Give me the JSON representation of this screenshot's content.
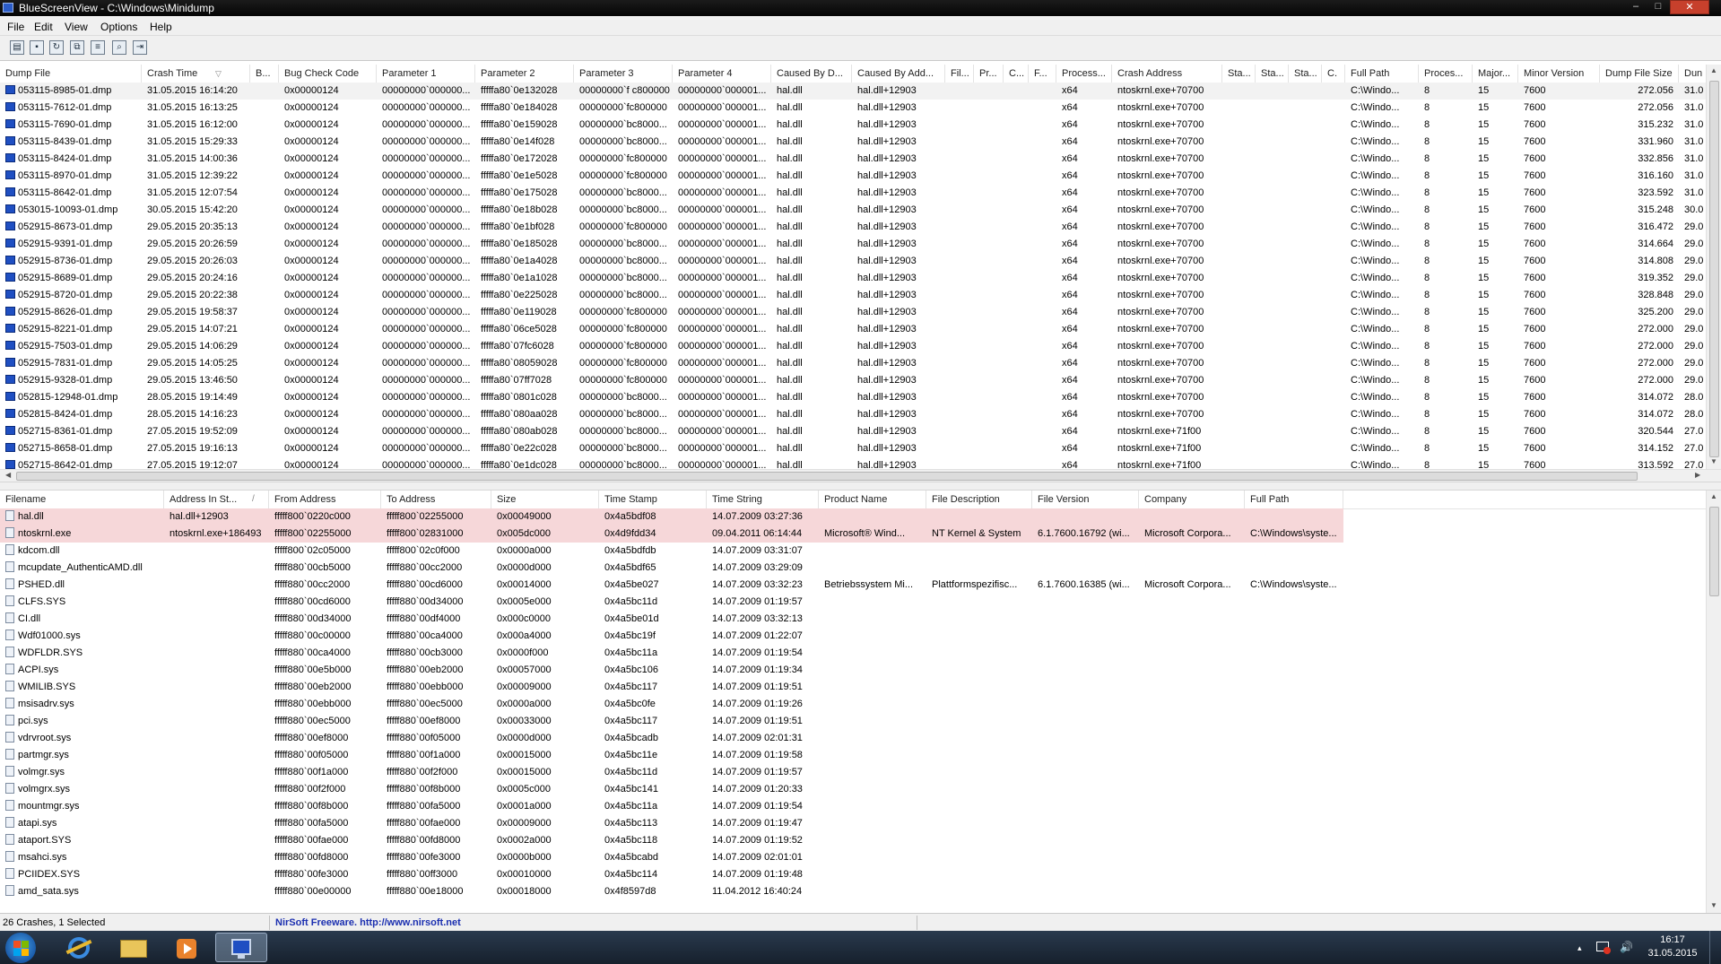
{
  "window": {
    "title": "BlueScreenView  -  C:\\Windows\\Minidump",
    "min_glyph": "–",
    "max_glyph": "□",
    "close_glyph": "✕"
  },
  "menu": [
    "File",
    "Edit",
    "View",
    "Options",
    "Help"
  ],
  "toolbar_icons": [
    "properties-icon",
    "save-icon",
    "refresh-icon",
    "copy-icon",
    "html-report-icon",
    "find-icon",
    "exit-icon"
  ],
  "crash_list": {
    "columns": [
      "Dump File",
      "Crash Time",
      "B...",
      "Bug Check Code",
      "Parameter 1",
      "Parameter 2",
      "Parameter 3",
      "Parameter 4",
      "Caused By D...",
      "Caused By Add...",
      "Fil...",
      "Pr...",
      "C...",
      "F...",
      "Process...",
      "Crash Address",
      "Sta...",
      "Sta...",
      "Sta...",
      "C.",
      "Full Path",
      "Proces...",
      "Major...",
      "Minor Version",
      "Dump File Size",
      "Dun"
    ],
    "sort_glyph": "▽",
    "rows": [
      [
        "053115-8985-01.dmp",
        "31.05.2015 16:14:20",
        "0x00000124",
        "00000000`000000...",
        "fffffa80`0e132028",
        "00000000`f c800000",
        "00000000`000001...",
        "hal.dll",
        "hal.dll+12903",
        "x64",
        "ntoskrnl.exe+70700",
        "C:\\Windo...",
        "8",
        "15",
        "7600",
        "272.056",
        "31.0"
      ],
      [
        "053115-7612-01.dmp",
        "31.05.2015 16:13:25",
        "0x00000124",
        "00000000`000000...",
        "fffffa80`0e184028",
        "00000000`fc800000",
        "00000000`000001...",
        "hal.dll",
        "hal.dll+12903",
        "x64",
        "ntoskrnl.exe+70700",
        "C:\\Windo...",
        "8",
        "15",
        "7600",
        "272.056",
        "31.0"
      ],
      [
        "053115-7690-01.dmp",
        "31.05.2015 16:12:00",
        "0x00000124",
        "00000000`000000...",
        "fffffa80`0e159028",
        "00000000`bc8000...",
        "00000000`000001...",
        "hal.dll",
        "hal.dll+12903",
        "x64",
        "ntoskrnl.exe+70700",
        "C:\\Windo...",
        "8",
        "15",
        "7600",
        "315.232",
        "31.0"
      ],
      [
        "053115-8439-01.dmp",
        "31.05.2015 15:29:33",
        "0x00000124",
        "00000000`000000...",
        "fffffa80`0e14f028",
        "00000000`bc8000...",
        "00000000`000001...",
        "hal.dll",
        "hal.dll+12903",
        "x64",
        "ntoskrnl.exe+70700",
        "C:\\Windo...",
        "8",
        "15",
        "7600",
        "331.960",
        "31.0"
      ],
      [
        "053115-8424-01.dmp",
        "31.05.2015 14:00:36",
        "0x00000124",
        "00000000`000000...",
        "fffffa80`0e172028",
        "00000000`fc800000",
        "00000000`000001...",
        "hal.dll",
        "hal.dll+12903",
        "x64",
        "ntoskrnl.exe+70700",
        "C:\\Windo...",
        "8",
        "15",
        "7600",
        "332.856",
        "31.0"
      ],
      [
        "053115-8970-01.dmp",
        "31.05.2015 12:39:22",
        "0x00000124",
        "00000000`000000...",
        "fffffa80`0e1e5028",
        "00000000`fc800000",
        "00000000`000001...",
        "hal.dll",
        "hal.dll+12903",
        "x64",
        "ntoskrnl.exe+70700",
        "C:\\Windo...",
        "8",
        "15",
        "7600",
        "316.160",
        "31.0"
      ],
      [
        "053115-8642-01.dmp",
        "31.05.2015 12:07:54",
        "0x00000124",
        "00000000`000000...",
        "fffffa80`0e175028",
        "00000000`bc8000...",
        "00000000`000001...",
        "hal.dll",
        "hal.dll+12903",
        "x64",
        "ntoskrnl.exe+70700",
        "C:\\Windo...",
        "8",
        "15",
        "7600",
        "323.592",
        "31.0"
      ],
      [
        "053015-10093-01.dmp",
        "30.05.2015 15:42:20",
        "0x00000124",
        "00000000`000000...",
        "fffffa80`0e18b028",
        "00000000`bc8000...",
        "00000000`000001...",
        "hal.dll",
        "hal.dll+12903",
        "x64",
        "ntoskrnl.exe+70700",
        "C:\\Windo...",
        "8",
        "15",
        "7600",
        "315.248",
        "30.0"
      ],
      [
        "052915-8673-01.dmp",
        "29.05.2015 20:35:13",
        "0x00000124",
        "00000000`000000...",
        "fffffa80`0e1bf028",
        "00000000`fc800000",
        "00000000`000001...",
        "hal.dll",
        "hal.dll+12903",
        "x64",
        "ntoskrnl.exe+70700",
        "C:\\Windo...",
        "8",
        "15",
        "7600",
        "316.472",
        "29.0"
      ],
      [
        "052915-9391-01.dmp",
        "29.05.2015 20:26:59",
        "0x00000124",
        "00000000`000000...",
        "fffffa80`0e185028",
        "00000000`bc8000...",
        "00000000`000001...",
        "hal.dll",
        "hal.dll+12903",
        "x64",
        "ntoskrnl.exe+70700",
        "C:\\Windo...",
        "8",
        "15",
        "7600",
        "314.664",
        "29.0"
      ],
      [
        "052915-8736-01.dmp",
        "29.05.2015 20:26:03",
        "0x00000124",
        "00000000`000000...",
        "fffffa80`0e1a4028",
        "00000000`bc8000...",
        "00000000`000001...",
        "hal.dll",
        "hal.dll+12903",
        "x64",
        "ntoskrnl.exe+70700",
        "C:\\Windo...",
        "8",
        "15",
        "7600",
        "314.808",
        "29.0"
      ],
      [
        "052915-8689-01.dmp",
        "29.05.2015 20:24:16",
        "0x00000124",
        "00000000`000000...",
        "fffffa80`0e1a1028",
        "00000000`bc8000...",
        "00000000`000001...",
        "hal.dll",
        "hal.dll+12903",
        "x64",
        "ntoskrnl.exe+70700",
        "C:\\Windo...",
        "8",
        "15",
        "7600",
        "319.352",
        "29.0"
      ],
      [
        "052915-8720-01.dmp",
        "29.05.2015 20:22:38",
        "0x00000124",
        "00000000`000000...",
        "fffffa80`0e225028",
        "00000000`bc8000...",
        "00000000`000001...",
        "hal.dll",
        "hal.dll+12903",
        "x64",
        "ntoskrnl.exe+70700",
        "C:\\Windo...",
        "8",
        "15",
        "7600",
        "328.848",
        "29.0"
      ],
      [
        "052915-8626-01.dmp",
        "29.05.2015 19:58:37",
        "0x00000124",
        "00000000`000000...",
        "fffffa80`0e119028",
        "00000000`fc800000",
        "00000000`000001...",
        "hal.dll",
        "hal.dll+12903",
        "x64",
        "ntoskrnl.exe+70700",
        "C:\\Windo...",
        "8",
        "15",
        "7600",
        "325.200",
        "29.0"
      ],
      [
        "052915-8221-01.dmp",
        "29.05.2015 14:07:21",
        "0x00000124",
        "00000000`000000...",
        "fffffa80`06ce5028",
        "00000000`fc800000",
        "00000000`000001...",
        "hal.dll",
        "hal.dll+12903",
        "x64",
        "ntoskrnl.exe+70700",
        "C:\\Windo...",
        "8",
        "15",
        "7600",
        "272.000",
        "29.0"
      ],
      [
        "052915-7503-01.dmp",
        "29.05.2015 14:06:29",
        "0x00000124",
        "00000000`000000...",
        "fffffa80`07fc6028",
        "00000000`fc800000",
        "00000000`000001...",
        "hal.dll",
        "hal.dll+12903",
        "x64",
        "ntoskrnl.exe+70700",
        "C:\\Windo...",
        "8",
        "15",
        "7600",
        "272.000",
        "29.0"
      ],
      [
        "052915-7831-01.dmp",
        "29.05.2015 14:05:25",
        "0x00000124",
        "00000000`000000...",
        "fffffa80`08059028",
        "00000000`fc800000",
        "00000000`000001...",
        "hal.dll",
        "hal.dll+12903",
        "x64",
        "ntoskrnl.exe+70700",
        "C:\\Windo...",
        "8",
        "15",
        "7600",
        "272.000",
        "29.0"
      ],
      [
        "052915-9328-01.dmp",
        "29.05.2015 13:46:50",
        "0x00000124",
        "00000000`000000...",
        "fffffa80`07ff7028",
        "00000000`fc800000",
        "00000000`000001...",
        "hal.dll",
        "hal.dll+12903",
        "x64",
        "ntoskrnl.exe+70700",
        "C:\\Windo...",
        "8",
        "15",
        "7600",
        "272.000",
        "29.0"
      ],
      [
        "052815-12948-01.dmp",
        "28.05.2015 19:14:49",
        "0x00000124",
        "00000000`000000...",
        "fffffa80`0801c028",
        "00000000`bc8000...",
        "00000000`000001...",
        "hal.dll",
        "hal.dll+12903",
        "x64",
        "ntoskrnl.exe+70700",
        "C:\\Windo...",
        "8",
        "15",
        "7600",
        "314.072",
        "28.0"
      ],
      [
        "052815-8424-01.dmp",
        "28.05.2015 14:16:23",
        "0x00000124",
        "00000000`000000...",
        "fffffa80`080aa028",
        "00000000`bc8000...",
        "00000000`000001...",
        "hal.dll",
        "hal.dll+12903",
        "x64",
        "ntoskrnl.exe+70700",
        "C:\\Windo...",
        "8",
        "15",
        "7600",
        "314.072",
        "28.0"
      ],
      [
        "052715-8361-01.dmp",
        "27.05.2015 19:52:09",
        "0x00000124",
        "00000000`000000...",
        "fffffa80`080ab028",
        "00000000`bc8000...",
        "00000000`000001...",
        "hal.dll",
        "hal.dll+12903",
        "x64",
        "ntoskrnl.exe+71f00",
        "C:\\Windo...",
        "8",
        "15",
        "7600",
        "320.544",
        "27.0"
      ],
      [
        "052715-8658-01.dmp",
        "27.05.2015 19:16:13",
        "0x00000124",
        "00000000`000000...",
        "fffffa80`0e22c028",
        "00000000`bc8000...",
        "00000000`000001...",
        "hal.dll",
        "hal.dll+12903",
        "x64",
        "ntoskrnl.exe+71f00",
        "C:\\Windo...",
        "8",
        "15",
        "7600",
        "314.152",
        "27.0"
      ],
      [
        "052715-8642-01.dmp",
        "27.05.2015 19:12:07",
        "0x00000124",
        "00000000`000000...",
        "fffffa80`0e1dc028",
        "00000000`bc8000...",
        "00000000`000001...",
        "hal.dll",
        "hal.dll+12903",
        "x64",
        "ntoskrnl.exe+71f00",
        "C:\\Windo...",
        "8",
        "15",
        "7600",
        "313.592",
        "27.0"
      ]
    ]
  },
  "driver_list": {
    "columns": [
      "Filename",
      "Address In St...",
      "From Address",
      "To Address",
      "Size",
      "Time Stamp",
      "Time String",
      "Product Name",
      "File Description",
      "File Version",
      "Company",
      "Full Path"
    ],
    "sort_glyph": "/",
    "rows": [
      [
        "hal.dll",
        "hal.dll+12903",
        "fffff800`0220c000",
        "fffff800`02255000",
        "0x00049000",
        "0x4a5bdf08",
        "14.07.2009 03:27:36",
        "",
        "",
        "",
        "",
        ""
      ],
      [
        "ntoskrnl.exe",
        "ntoskrnl.exe+186493",
        "fffff800`02255000",
        "fffff800`02831000",
        "0x005dc000",
        "0x4d9fdd34",
        "09.04.2011 06:14:44",
        "Microsoft® Wind...",
        "NT Kernel & System",
        "6.1.7600.16792 (wi...",
        "Microsoft Corpora...",
        "C:\\Windows\\syste..."
      ],
      [
        "kdcom.dll",
        "",
        "fffff800`02c05000",
        "fffff800`02c0f000",
        "0x0000a000",
        "0x4a5bdfdb",
        "14.07.2009 03:31:07",
        "",
        "",
        "",
        "",
        ""
      ],
      [
        "mcupdate_AuthenticAMD.dll",
        "",
        "fffff880`00cb5000",
        "fffff880`00cc2000",
        "0x0000d000",
        "0x4a5bdf65",
        "14.07.2009 03:29:09",
        "",
        "",
        "",
        "",
        ""
      ],
      [
        "PSHED.dll",
        "",
        "fffff880`00cc2000",
        "fffff880`00cd6000",
        "0x00014000",
        "0x4a5be027",
        "14.07.2009 03:32:23",
        "Betriebssystem Mi...",
        "Plattformspezifisc...",
        "6.1.7600.16385 (wi...",
        "Microsoft Corpora...",
        "C:\\Windows\\syste..."
      ],
      [
        "CLFS.SYS",
        "",
        "fffff880`00cd6000",
        "fffff880`00d34000",
        "0x0005e000",
        "0x4a5bc11d",
        "14.07.2009 01:19:57",
        "",
        "",
        "",
        "",
        ""
      ],
      [
        "CI.dll",
        "",
        "fffff880`00d34000",
        "fffff880`00df4000",
        "0x000c0000",
        "0x4a5be01d",
        "14.07.2009 03:32:13",
        "",
        "",
        "",
        "",
        ""
      ],
      [
        "Wdf01000.sys",
        "",
        "fffff880`00c00000",
        "fffff880`00ca4000",
        "0x000a4000",
        "0x4a5bc19f",
        "14.07.2009 01:22:07",
        "",
        "",
        "",
        "",
        ""
      ],
      [
        "WDFLDR.SYS",
        "",
        "fffff880`00ca4000",
        "fffff880`00cb3000",
        "0x0000f000",
        "0x4a5bc11a",
        "14.07.2009 01:19:54",
        "",
        "",
        "",
        "",
        ""
      ],
      [
        "ACPI.sys",
        "",
        "fffff880`00e5b000",
        "fffff880`00eb2000",
        "0x00057000",
        "0x4a5bc106",
        "14.07.2009 01:19:34",
        "",
        "",
        "",
        "",
        ""
      ],
      [
        "WMILIB.SYS",
        "",
        "fffff880`00eb2000",
        "fffff880`00ebb000",
        "0x00009000",
        "0x4a5bc117",
        "14.07.2009 01:19:51",
        "",
        "",
        "",
        "",
        ""
      ],
      [
        "msisadrv.sys",
        "",
        "fffff880`00ebb000",
        "fffff880`00ec5000",
        "0x0000a000",
        "0x4a5bc0fe",
        "14.07.2009 01:19:26",
        "",
        "",
        "",
        "",
        ""
      ],
      [
        "pci.sys",
        "",
        "fffff880`00ec5000",
        "fffff880`00ef8000",
        "0x00033000",
        "0x4a5bc117",
        "14.07.2009 01:19:51",
        "",
        "",
        "",
        "",
        ""
      ],
      [
        "vdrvroot.sys",
        "",
        "fffff880`00ef8000",
        "fffff880`00f05000",
        "0x0000d000",
        "0x4a5bcadb",
        "14.07.2009 02:01:31",
        "",
        "",
        "",
        "",
        ""
      ],
      [
        "partmgr.sys",
        "",
        "fffff880`00f05000",
        "fffff880`00f1a000",
        "0x00015000",
        "0x4a5bc11e",
        "14.07.2009 01:19:58",
        "",
        "",
        "",
        "",
        ""
      ],
      [
        "volmgr.sys",
        "",
        "fffff880`00f1a000",
        "fffff880`00f2f000",
        "0x00015000",
        "0x4a5bc11d",
        "14.07.2009 01:19:57",
        "",
        "",
        "",
        "",
        ""
      ],
      [
        "volmgrx.sys",
        "",
        "fffff880`00f2f000",
        "fffff880`00f8b000",
        "0x0005c000",
        "0x4a5bc141",
        "14.07.2009 01:20:33",
        "",
        "",
        "",
        "",
        ""
      ],
      [
        "mountmgr.sys",
        "",
        "fffff880`00f8b000",
        "fffff880`00fa5000",
        "0x0001a000",
        "0x4a5bc11a",
        "14.07.2009 01:19:54",
        "",
        "",
        "",
        "",
        ""
      ],
      [
        "atapi.sys",
        "",
        "fffff880`00fa5000",
        "fffff880`00fae000",
        "0x00009000",
        "0x4a5bc113",
        "14.07.2009 01:19:47",
        "",
        "",
        "",
        "",
        ""
      ],
      [
        "ataport.SYS",
        "",
        "fffff880`00fae000",
        "fffff880`00fd8000",
        "0x0002a000",
        "0x4a5bc118",
        "14.07.2009 01:19:52",
        "",
        "",
        "",
        "",
        ""
      ],
      [
        "msahci.sys",
        "",
        "fffff880`00fd8000",
        "fffff880`00fe3000",
        "0x0000b000",
        "0x4a5bcabd",
        "14.07.2009 02:01:01",
        "",
        "",
        "",
        "",
        ""
      ],
      [
        "PCIIDEX.SYS",
        "",
        "fffff880`00fe3000",
        "fffff880`00ff3000",
        "0x00010000",
        "0x4a5bc114",
        "14.07.2009 01:19:48",
        "",
        "",
        "",
        "",
        ""
      ],
      [
        "amd_sata.sys",
        "",
        "fffff880`00e00000",
        "fffff880`00e18000",
        "0x00018000",
        "0x4f8597d8",
        "11.04.2012 16:40:24",
        "",
        "",
        "",
        "",
        ""
      ]
    ]
  },
  "status": {
    "count": "26 Crashes, 1 Selected",
    "link": "NirSoft Freeware.  http://www.nirsoft.net"
  },
  "taskbar": {
    "clock_time": "16:17",
    "clock_date": "31.05.2015",
    "show_hidden_glyph": "▴",
    "volume_glyph": "🔊"
  },
  "colors": {
    "highlight_row": "#f6d7d9",
    "link": "#1b2fb0"
  }
}
